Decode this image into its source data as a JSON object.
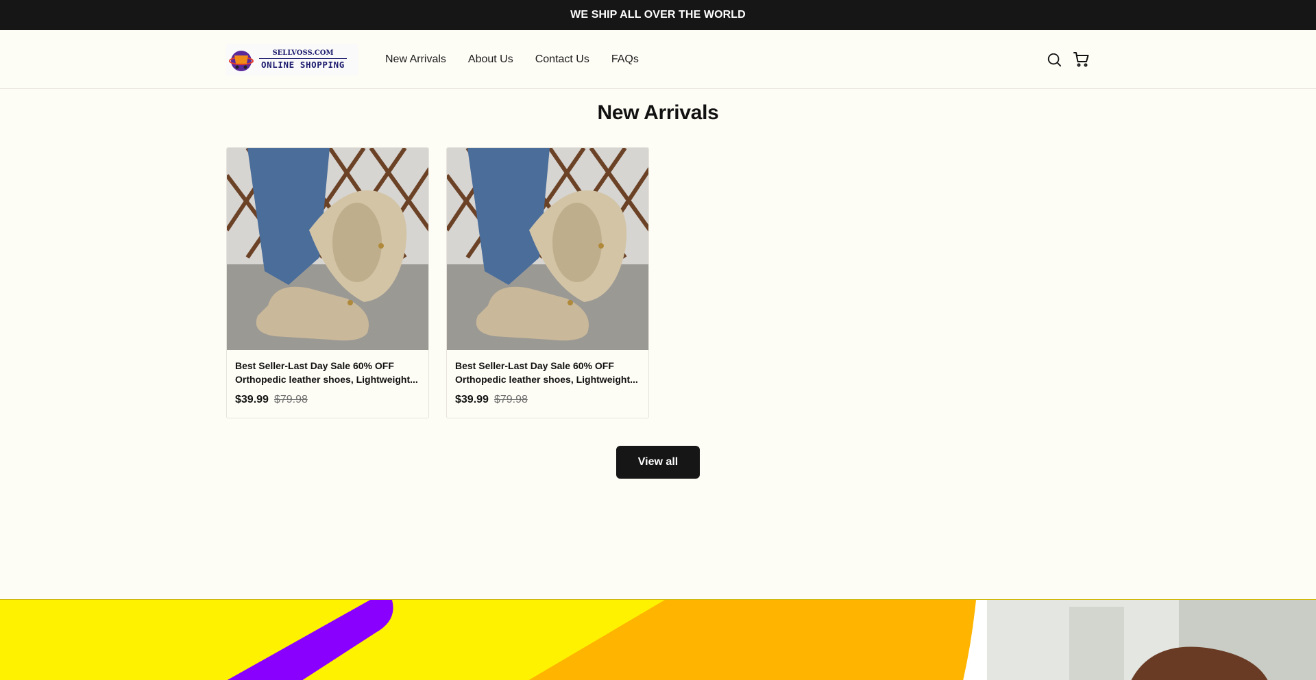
{
  "announcement": {
    "text": "WE SHIP ALL OVER THE WORLD"
  },
  "header": {
    "logo": {
      "top_text": "SELLVOSS.COM",
      "bottom_text": "ONLINE SHOPPING"
    },
    "nav": [
      {
        "label": "New Arrivals"
      },
      {
        "label": "About Us"
      },
      {
        "label": "Contact Us"
      },
      {
        "label": "FAQs"
      }
    ],
    "icons": [
      "search-icon",
      "cart-icon"
    ]
  },
  "section": {
    "title": "New Arrivals",
    "view_all_label": "View all"
  },
  "products": [
    {
      "title": "Best Seller-Last Day Sale 60% OFF Orthopedic leather shoes, Lightweight...",
      "price": "$39.99",
      "compare_price": "$79.98"
    },
    {
      "title": "Best Seller-Last Day Sale 60% OFF Orthopedic leather shoes, Lightweight...",
      "price": "$39.99",
      "compare_price": "$79.98"
    }
  ],
  "colors": {
    "announcement_bg": "#161616",
    "page_bg": "#fdfcf5",
    "button_bg": "#161616",
    "banner_yellow": "#fff200",
    "banner_orange": "#ffb400",
    "banner_purple": "#8a00ff"
  }
}
